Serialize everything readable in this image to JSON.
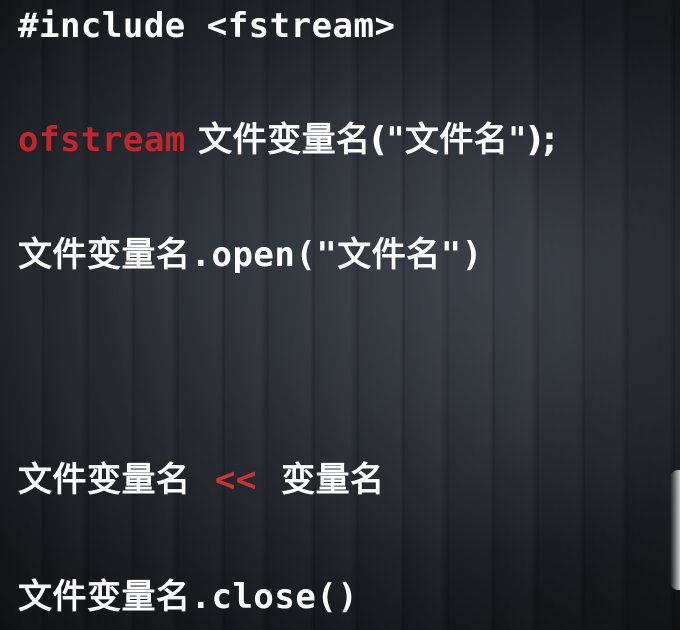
{
  "code": {
    "include_line": "#include <fstream>",
    "ofstream_line": {
      "keyword": "ofstream",
      "declaration": "文件变量名(\"文件名\");"
    },
    "open_line": {
      "variable": "文件变量名",
      "call": ".open(\"文件名\")"
    },
    "output_line": {
      "variable": "文件变量名",
      "operator": "<<",
      "value": "变量名"
    },
    "close_line": {
      "variable": "文件变量名",
      "call": ".close()"
    }
  },
  "colors": {
    "text": "#ffffff",
    "keyword": "#c0262d",
    "background": "#22262c"
  }
}
